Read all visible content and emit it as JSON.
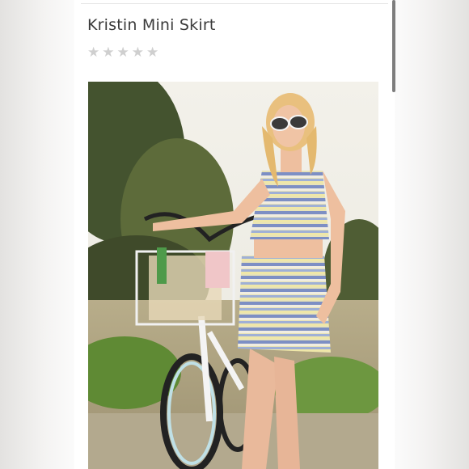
{
  "product": {
    "title": "Kristin Mini Skirt",
    "rating": {
      "stars": [
        "★",
        "★",
        "★",
        "★",
        "★"
      ],
      "filled": 0,
      "star_color": "#cfcfcf"
    }
  },
  "photo": {
    "icon": "product-photo"
  },
  "colors": {
    "page_bg": "#ecebe9",
    "card_bg": "#ffffff",
    "title_text": "#3a3a3a",
    "scrollbar": "#7d7d7d"
  }
}
